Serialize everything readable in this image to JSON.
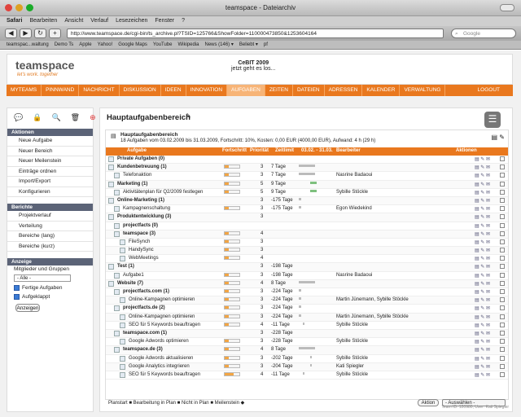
{
  "window": {
    "title": "teamspace - Dateiarchiv"
  },
  "menu": [
    "Safari",
    "Bearbeiten",
    "Ansicht",
    "Verlauf",
    "Lesezeichen",
    "Fenster",
    "?"
  ],
  "toolbar": {
    "url": "http://www.teamspace.de/cgi-bin/ts_archive.pl?TSID=125766&ShowFolder=110000473850&1253604164",
    "search_placeholder": "Google"
  },
  "bookmarks": [
    "teamspac...waltung",
    "Demo Ts",
    "Apple",
    "Yahoo!",
    "Google Maps",
    "YouTube",
    "Wikipedia",
    "News (146) ▾",
    "Beliebt ▾",
    "pf"
  ],
  "header": {
    "logo": "teamspace",
    "tagline": "let's work. together",
    "event_name": "CeBIT 2009",
    "event_status": "jetzt geht es los..."
  },
  "nav": {
    "items": [
      "MYTEAMS",
      "PINNWAND",
      "NACHRICHT",
      "DISKUSSION",
      "IDEEN",
      "INNOVATION",
      "AUFGABEN",
      "ZEITEN",
      "DATEIEN",
      "ADRESSEN",
      "KALENDER",
      "VERWALTUNG"
    ],
    "active": "AUFGABEN",
    "logout": "LOGOUT"
  },
  "sidebar": {
    "aktionen_title": "Aktionen",
    "aktionen": [
      "Neue Aufgabe",
      "Neuer Bereich",
      "Neuer Meilenstein",
      "Einträge ordnen",
      "Import/Export",
      "Konfigurieren"
    ],
    "berichte_title": "Berichte",
    "berichte": [
      "Projektverlauf",
      "Verteilung",
      "Bereiche (lang)",
      "Bereiche (kurz)"
    ],
    "anzeige_title": "Anzeige",
    "mitglieder_label": "Mitglieder und Gruppen",
    "select_value": "- Alle -",
    "check1": "Fertige Aufgaben",
    "check2": "Aufgeklappt",
    "anzeigen_button": "Anzeigen"
  },
  "main": {
    "title": "Hauptaufgabenbereich",
    "proj_title": "Hauptaufgabenbereich",
    "proj_info": "18 Aufgaben vom 03.02.2009 bis 31.03.2009, Fortschritt: 10%, Kosten: 0,00 EUR (4000,00 EUR), Aufwand: 4 h (29 h)",
    "columns": {
      "aufgabe": "Aufgabe",
      "fortschritt": "Fortschritt",
      "prioritaet": "Priorität",
      "zeitlimit": "Zeitlimit",
      "zeitraum": "03.02. - 31.03.",
      "bearbeiter": "Bearbeiter",
      "aktionen": "Aktionen"
    },
    "rows": [
      {
        "name": "Private Aufgaben (0)",
        "prio": "",
        "zeit": "",
        "bearb": "",
        "bold": true,
        "indent": 0,
        "progress": null,
        "gx": 0,
        "gw": 0
      },
      {
        "name": "Kundenbetreuung (1)",
        "prio": "3",
        "zeit": "7 Tage",
        "bearb": "",
        "bold": true,
        "indent": 0,
        "progress": 0.3,
        "gx": 0,
        "gw": 20
      },
      {
        "name": "Telefonaktion",
        "prio": "3",
        "zeit": "7 Tage",
        "bearb": "Nasrine Badaoui",
        "bold": false,
        "indent": 1,
        "progress": 0.3,
        "gx": 0,
        "gw": 20
      },
      {
        "name": "Marketing (1)",
        "prio": "5",
        "zeit": "9 Tage",
        "bearb": "",
        "bold": true,
        "indent": 0,
        "progress": 0.3,
        "gx": 14,
        "gw": 8,
        "green": true
      },
      {
        "name": "Aktivitätenplan für Q2/2009 festlegen",
        "prio": "5",
        "zeit": "9 Tage",
        "bearb": "Sybille Stöckle",
        "bold": false,
        "indent": 1,
        "progress": 0.3,
        "gx": 14,
        "gw": 8,
        "green": true
      },
      {
        "name": "Online-Marketing (1)",
        "prio": "3",
        "zeit": "-175 Tage",
        "bearb": "",
        "bold": true,
        "indent": 0,
        "progress": null,
        "gx": 0,
        "gw": 3
      },
      {
        "name": "Kampagnenschaltung",
        "prio": "3",
        "zeit": "-175 Tage",
        "bearb": "Egon Wiedekind",
        "bold": false,
        "indent": 1,
        "progress": 0.3,
        "gx": 0,
        "gw": 3
      },
      {
        "name": "Produktentwicklung (3)",
        "prio": "3",
        "zeit": "",
        "bearb": "",
        "bold": true,
        "indent": 0,
        "progress": null,
        "gx": 0,
        "gw": 0
      },
      {
        "name": "projectfacts (0)",
        "prio": "",
        "zeit": "",
        "bearb": "",
        "bold": true,
        "indent": 1,
        "progress": null,
        "gx": 0,
        "gw": 0
      },
      {
        "name": "teamspace (3)",
        "prio": "4",
        "zeit": "",
        "bearb": "",
        "bold": true,
        "indent": 1,
        "progress": 0.3,
        "gx": 0,
        "gw": 0
      },
      {
        "name": "FileSynch",
        "prio": "3",
        "zeit": "",
        "bearb": "",
        "bold": false,
        "indent": 2,
        "progress": 0.3,
        "gx": 0,
        "gw": 0
      },
      {
        "name": "HandySync",
        "prio": "3",
        "zeit": "",
        "bearb": "",
        "bold": false,
        "indent": 2,
        "progress": 0.3,
        "gx": 0,
        "gw": 0
      },
      {
        "name": "WebMeetings",
        "prio": "4",
        "zeit": "",
        "bearb": "",
        "bold": false,
        "indent": 2,
        "progress": 0.3,
        "gx": 0,
        "gw": 0
      },
      {
        "name": "Test (1)",
        "prio": "3",
        "zeit": "-198 Tage",
        "bearb": "",
        "bold": true,
        "indent": 0,
        "progress": null,
        "gx": 0,
        "gw": 0
      },
      {
        "name": "Aufgabe1",
        "prio": "3",
        "zeit": "-198 Tage",
        "bearb": "Nasrine Badaoui",
        "bold": false,
        "indent": 1,
        "progress": 0.3,
        "gx": 0,
        "gw": 0
      },
      {
        "name": "Website (7)",
        "prio": "4",
        "zeit": "8 Tage",
        "bearb": "",
        "bold": true,
        "indent": 0,
        "progress": 0.3,
        "gx": 0,
        "gw": 20
      },
      {
        "name": "projectfacts.com (1)",
        "prio": "3",
        "zeit": "-224 Tage",
        "bearb": "",
        "bold": true,
        "indent": 1,
        "progress": 0.3,
        "gx": 0,
        "gw": 3
      },
      {
        "name": "Online-Kampagnen optimieren",
        "prio": "3",
        "zeit": "-224 Tage",
        "bearb": "Martin Jünemann, Sybille Stöckle",
        "bold": false,
        "indent": 2,
        "progress": 0.3,
        "gx": 0,
        "gw": 3
      },
      {
        "name": "projectfacts.de (2)",
        "prio": "3",
        "zeit": "-224 Tage",
        "bearb": "",
        "bold": true,
        "indent": 1,
        "progress": 0.3,
        "gx": 0,
        "gw": 3
      },
      {
        "name": "Online-Kampagnen optimieren",
        "prio": "3",
        "zeit": "-224 Tage",
        "bearb": "Martin Jünemann, Sybille Stöckle",
        "bold": false,
        "indent": 2,
        "progress": 0.3,
        "gx": 0,
        "gw": 3
      },
      {
        "name": "SEO für 5 Keywords beauftragen",
        "prio": "4",
        "zeit": "-11 Tage",
        "bearb": "Sybille Stöckle",
        "bold": false,
        "indent": 2,
        "progress": 0.3,
        "gx": 5,
        "gw": 2
      },
      {
        "name": "teamspace.com (1)",
        "prio": "3",
        "zeit": "-228 Tage",
        "bearb": "",
        "bold": true,
        "indent": 1,
        "progress": null,
        "gx": 0,
        "gw": 0
      },
      {
        "name": "Google Adwords optimieren",
        "prio": "3",
        "zeit": "-228 Tage",
        "bearb": "Sybille Stöckle",
        "bold": false,
        "indent": 2,
        "progress": 0.3,
        "gx": 0,
        "gw": 0
      },
      {
        "name": "teamspace.de (3)",
        "prio": "4",
        "zeit": "8 Tage",
        "bearb": "",
        "bold": true,
        "indent": 1,
        "progress": 0.3,
        "gx": 0,
        "gw": 20
      },
      {
        "name": "Google Adwords aktualisieren",
        "prio": "3",
        "zeit": "-202 Tage",
        "bearb": "Sybille Stöckle",
        "bold": false,
        "indent": 2,
        "progress": 0.3,
        "gx": 14,
        "gw": 2
      },
      {
        "name": "Google Analytics integrieren",
        "prio": "3",
        "zeit": "-204 Tage",
        "bearb": "Kati Spiegler",
        "bold": false,
        "indent": 2,
        "progress": 0.3,
        "gx": 14,
        "gw": 2
      },
      {
        "name": "SEO für 5 Keywords beauftragen",
        "prio": "4",
        "zeit": "-11 Tage",
        "bearb": "Sybille Stöckle",
        "bold": false,
        "indent": 2,
        "progress": 0.6,
        "gx": 5,
        "gw": 2
      }
    ],
    "legend": "Planstart ■ Bearbeitung in Plan ■ Nicht in Plan ■ Meilenstein ◆",
    "aktion_button": "Aktion",
    "auswaehlen": "- Auswählen -",
    "team_id": "Team ID: 120980, User: Kati Spiegler"
  }
}
